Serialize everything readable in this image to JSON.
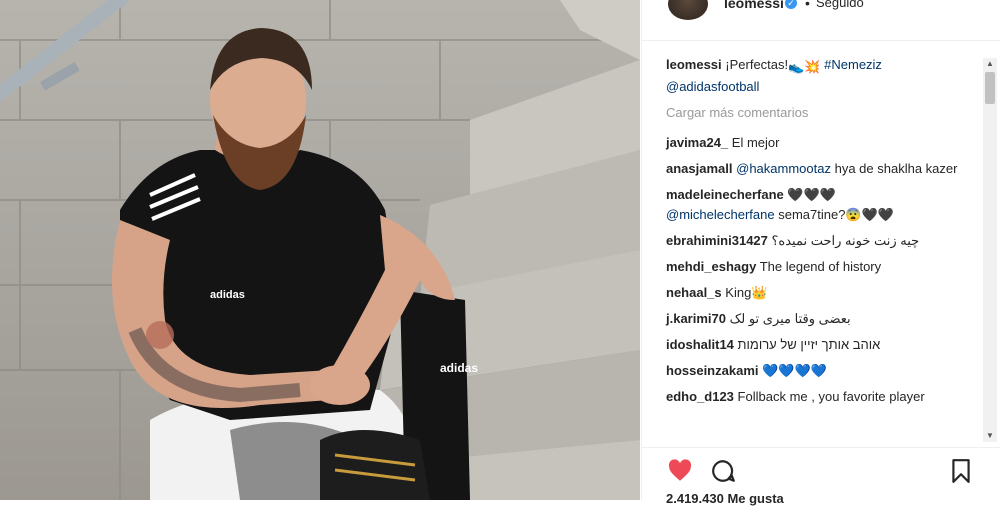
{
  "header": {
    "username": "leomessi",
    "verified_symbol": "✓",
    "separator": "•",
    "follow_status": "Seguido"
  },
  "caption": {
    "username": "leomessi",
    "text": "¡Perfectas!",
    "hashtag": "#Nemeziz",
    "mention": "@adidasfootball"
  },
  "load_more": "Cargar más comentarios",
  "comments": [
    {
      "user": "javima24_",
      "text": "El mejor"
    },
    {
      "user": "anasjamall",
      "mention": "@hakammootaz",
      "text": "hya de shaklha kazer"
    },
    {
      "user": "madeleinecherfane",
      "text": "🖤🖤🖤",
      "mention": "@michelecherfane",
      "text2": "sema7tine?😨🖤🖤"
    },
    {
      "user": "ebrahimini31427",
      "text": "چيه زنت خونه راحت نميده؟"
    },
    {
      "user": "mehdi_eshagy",
      "text": "The legend of history"
    },
    {
      "user": "nehaal_s",
      "text": "King👑"
    },
    {
      "user": "j.karimi70",
      "text": "بعضی وقتا میری تو لک"
    },
    {
      "user": "idoshalit14",
      "text": "אוהב אותך יזיין של ערומות"
    },
    {
      "user": "hosseinzakami",
      "text": "💙💙💙💙"
    },
    {
      "user": "edho_d123",
      "text": "Follback me , you favorite player"
    }
  ],
  "likes_text": "2.419.430 Me gusta",
  "icons": {
    "like": "heart-icon",
    "comment": "comment-icon",
    "save": "bookmark-icon"
  },
  "colors": {
    "like_red": "#ed4956",
    "link_blue": "#003569",
    "muted": "#999999",
    "verified_blue": "#3897f0"
  }
}
